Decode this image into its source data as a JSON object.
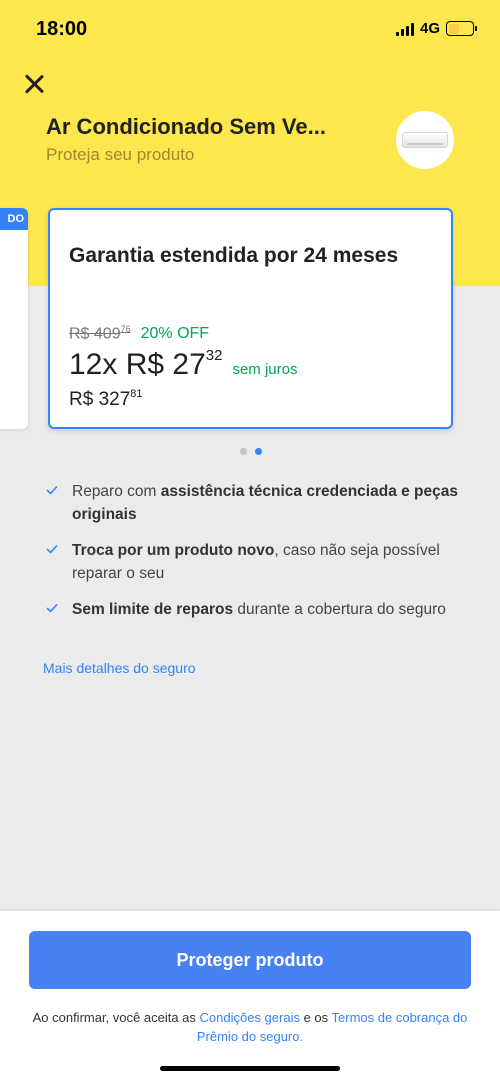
{
  "status_bar": {
    "time": "18:00",
    "network": "4G",
    "battery_level": 0.45,
    "signal_bars": 4
  },
  "header": {
    "product_title": "Ar Condicionado Sem Ve...",
    "subtitle": "Proteja seu produto",
    "close_icon": "close-icon",
    "thumbnail_icon": "air-conditioner-icon"
  },
  "previous_card": {
    "tag": "DO"
  },
  "plan": {
    "title": "Garantia estendida por 24 meses",
    "old_price": "R$ 409",
    "old_price_cents": "76",
    "discount": "20% OFF",
    "installments": "12x R$ 27",
    "installments_cents": "32",
    "no_interest": "sem juros",
    "total": "R$ 327",
    "total_cents": "81"
  },
  "carousel": {
    "pages": 2,
    "active_index": 1
  },
  "benefits": [
    {
      "pre": "Reparo com ",
      "bold": "assistência técnica credenciada e peças originais",
      "post": ""
    },
    {
      "pre": "",
      "bold": "Troca por um produto novo",
      "post": ", caso não seja possível reparar o seu"
    },
    {
      "pre": "",
      "bold": "Sem limite de reparos",
      "post": " durante a cobertura do seguro"
    }
  ],
  "details_link": "Mais detalhes do seguro",
  "footer": {
    "button_label": "Proteger produto",
    "disclaimer_pre": "Ao confirmar, você aceita as ",
    "link_conditions": "Condições gerais",
    "disclaimer_mid": " e os ",
    "link_terms": "Termos de cobrança do Prêmio do seguro."
  },
  "colors": {
    "brand_yellow": "#fde74c",
    "accent_blue": "#3483fa",
    "success_green": "#00a650",
    "button_blue": "#4682f2"
  }
}
